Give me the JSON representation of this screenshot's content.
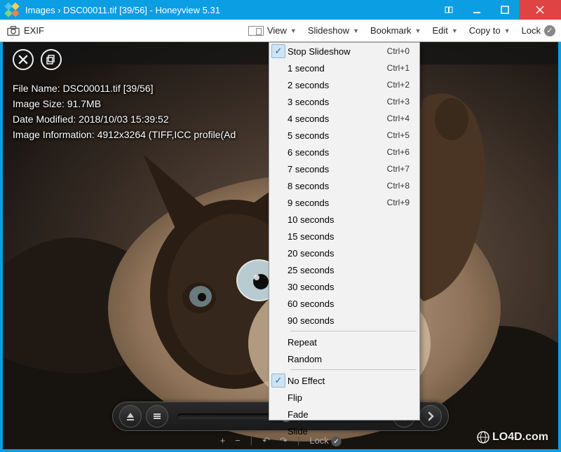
{
  "window": {
    "title": "Images  ›  DSC00011.tif [39/56] - Honeyview 5.31"
  },
  "toolbar": {
    "exif": "EXIF",
    "view": "View",
    "slideshow": "Slideshow",
    "bookmark": "Bookmark",
    "edit": "Edit",
    "copyto": "Copy to",
    "lock": "Lock"
  },
  "info": {
    "line1": "File Name: DSC00011.tif [39/56]",
    "line2": "Image Size: 91.7MB",
    "line3": "Date Modified: 2018/10/03 15:39:52",
    "line4": "Image Information: 4912x3264 (TIFF,ICC profile(Ad"
  },
  "dropdown": {
    "items": [
      {
        "label": "Stop Slideshow",
        "shortcut": "Ctrl+0",
        "checked": true
      },
      {
        "label": "1 second",
        "shortcut": "Ctrl+1",
        "checked": false
      },
      {
        "label": "2 seconds",
        "shortcut": "Ctrl+2",
        "checked": false
      },
      {
        "label": "3 seconds",
        "shortcut": "Ctrl+3",
        "checked": false
      },
      {
        "label": "4 seconds",
        "shortcut": "Ctrl+4",
        "checked": false
      },
      {
        "label": "5 seconds",
        "shortcut": "Ctrl+5",
        "checked": false
      },
      {
        "label": "6 seconds",
        "shortcut": "Ctrl+6",
        "checked": false
      },
      {
        "label": "7 seconds",
        "shortcut": "Ctrl+7",
        "checked": false
      },
      {
        "label": "8 seconds",
        "shortcut": "Ctrl+8",
        "checked": false
      },
      {
        "label": "9 seconds",
        "shortcut": "Ctrl+9",
        "checked": false
      },
      {
        "label": "10 seconds",
        "shortcut": "",
        "checked": false
      },
      {
        "label": "15 seconds",
        "shortcut": "",
        "checked": false
      },
      {
        "label": "20 seconds",
        "shortcut": "",
        "checked": false
      },
      {
        "label": "25 seconds",
        "shortcut": "",
        "checked": false
      },
      {
        "label": "30 seconds",
        "shortcut": "",
        "checked": false
      },
      {
        "label": "60 seconds",
        "shortcut": "",
        "checked": false
      },
      {
        "label": "90 seconds",
        "shortcut": "",
        "checked": false
      }
    ],
    "items2": [
      {
        "label": "Repeat",
        "checked": false
      },
      {
        "label": "Random",
        "checked": false
      }
    ],
    "items3": [
      {
        "label": "No Effect",
        "checked": true
      },
      {
        "label": "Flip",
        "checked": false
      },
      {
        "label": "Fade",
        "checked": false
      },
      {
        "label": "Slide",
        "checked": false
      }
    ]
  },
  "bottombar": {
    "plus": "+",
    "minus": "−",
    "undo": "↶",
    "redo": "↷",
    "lock": "Lock"
  },
  "watermark": "LO4D.com"
}
